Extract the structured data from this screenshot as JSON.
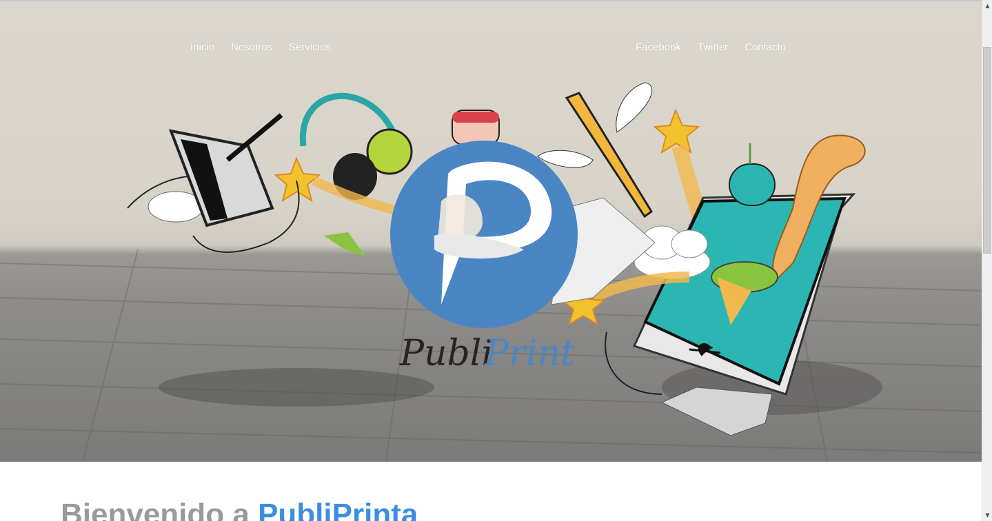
{
  "nav": {
    "left": [
      "Inicio",
      "Nosotros",
      "Servicios"
    ],
    "right": [
      "Facebook",
      "Twitter",
      "Contacto"
    ]
  },
  "hero": {
    "logo_text_dark": "Publi",
    "logo_text_blue": "Print"
  },
  "main": {
    "welcome_prefix": "Bienvenido a ",
    "welcome_brand": "PubliPrinta"
  },
  "colors": {
    "brand_blue": "#4a86c4",
    "heading_gray": "#9a9a9a",
    "heading_blue": "#3b8ee0"
  },
  "scrollbar": {
    "up_icon": "scroll-up-arrow-icon",
    "down_icon": "scroll-down-arrow-icon"
  }
}
